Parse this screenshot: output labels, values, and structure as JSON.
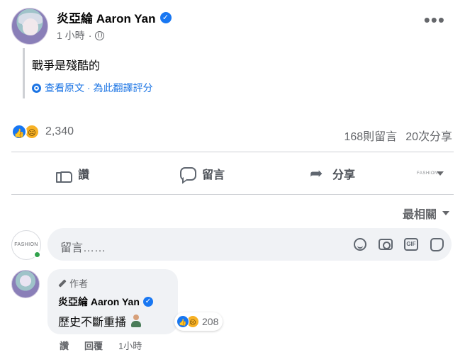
{
  "post": {
    "author": "炎亞綸 Aaron Yan",
    "time": "1 小時",
    "text": "戰爭是殘酷的",
    "translation_links": "查看原文 · 為此翻譯評分"
  },
  "reactions": {
    "count": "2,340",
    "comments": "168則留言",
    "shares": "20次分享"
  },
  "actions": {
    "like": "讚",
    "comment": "留言",
    "share": "分享",
    "page_avatar_text": "FASHION"
  },
  "sort": {
    "label": "最相關"
  },
  "composer": {
    "avatar_text": "FASHION",
    "placeholder": "留言……"
  },
  "comment": {
    "badge": "作者",
    "author": "炎亞綸 Aaron Yan",
    "text": "歷史不斷重播",
    "reaction_count": "208",
    "like_label": "讚",
    "reply_label": "回覆",
    "time": "1小時"
  },
  "colors": {
    "accent": "#1877f2",
    "link": "#1b74e4",
    "secondary_text": "#65676b",
    "bubble": "#f0f2f5",
    "online": "#31a24c"
  },
  "icons": [
    "globe-icon",
    "more-icon",
    "gear-icon",
    "like-icon",
    "comment-icon",
    "share-icon",
    "smile-icon",
    "camera-icon",
    "gif-icon",
    "sticker-icon",
    "pen-icon",
    "verified-icon"
  ]
}
